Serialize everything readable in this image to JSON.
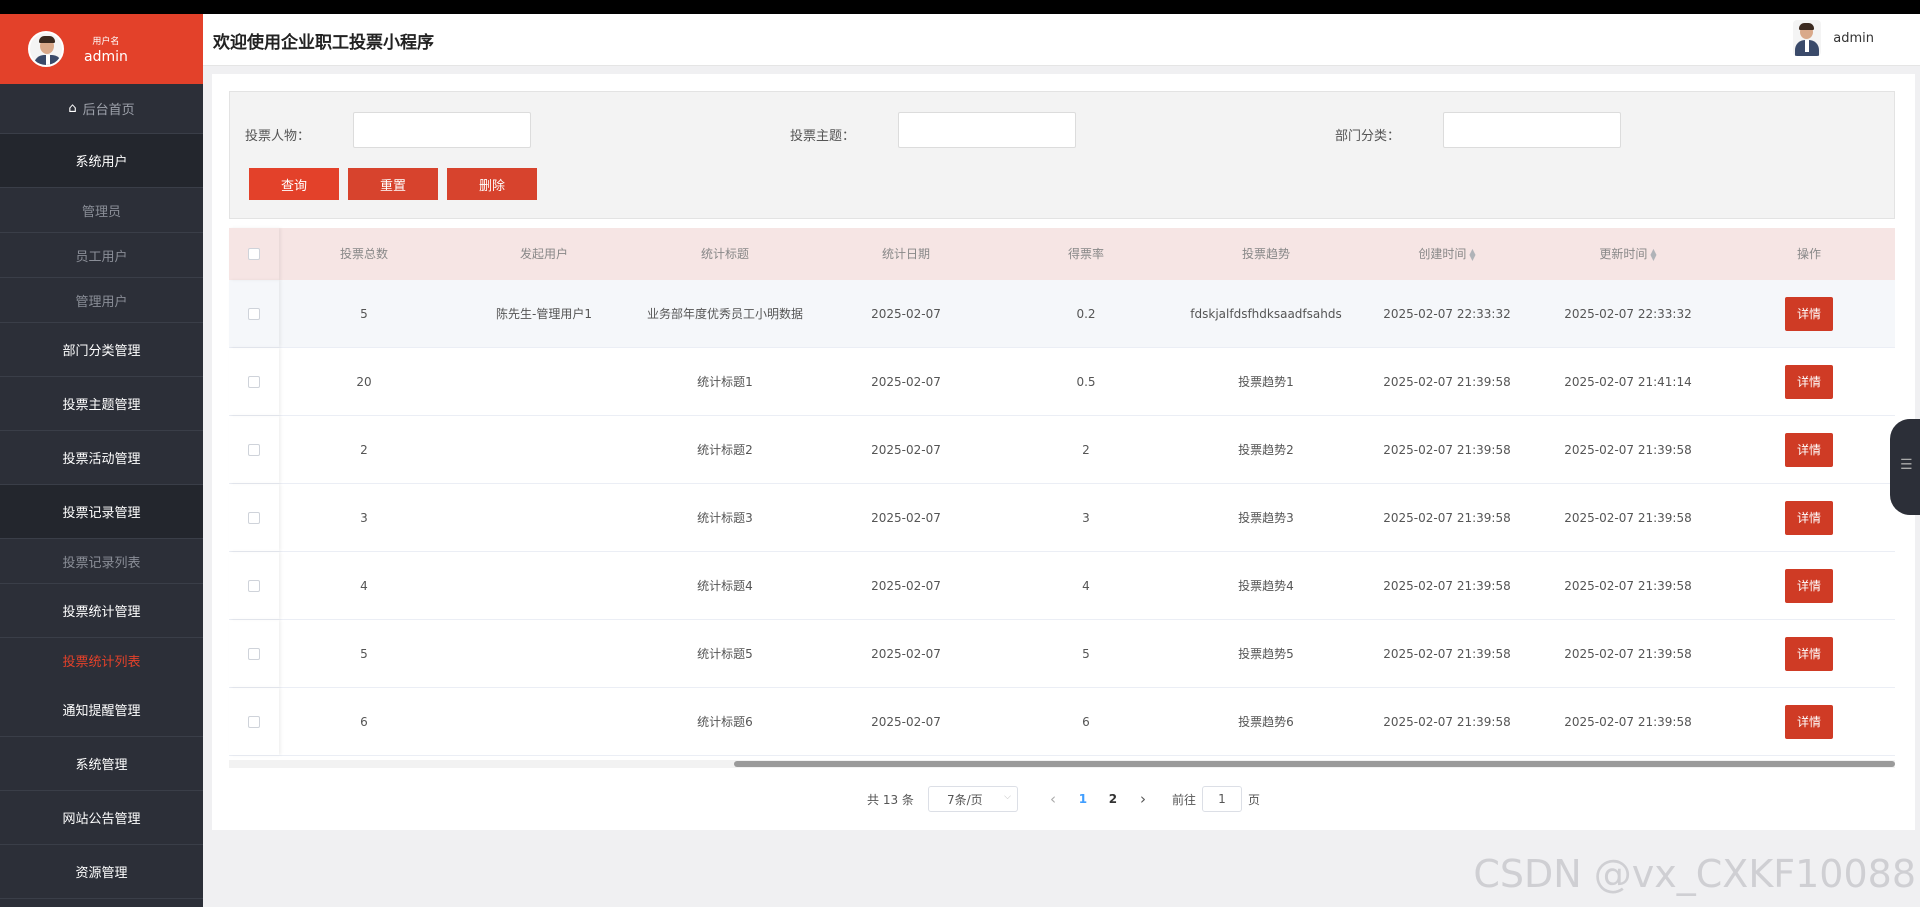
{
  "header": {
    "title": "欢迎使用企业职工投票小程序",
    "username": "admin"
  },
  "sidebar": {
    "user_label": "用户名",
    "user_name": "admin",
    "home": "后台首页",
    "items": [
      {
        "label": "系统用户",
        "type": "group"
      },
      {
        "label": "管理员",
        "type": "sub"
      },
      {
        "label": "员工用户",
        "type": "sub"
      },
      {
        "label": "管理用户",
        "type": "sub"
      },
      {
        "label": "部门分类管理",
        "type": "group"
      },
      {
        "label": "投票主题管理",
        "type": "group"
      },
      {
        "label": "投票活动管理",
        "type": "group"
      },
      {
        "label": "投票记录管理",
        "type": "group"
      },
      {
        "label": "投票记录列表",
        "type": "sub"
      },
      {
        "label": "投票统计管理",
        "type": "group"
      },
      {
        "label": "投票统计列表",
        "type": "sub-active"
      },
      {
        "label": "通知提醒管理",
        "type": "group"
      },
      {
        "label": "系统管理",
        "type": "group"
      },
      {
        "label": "网站公告管理",
        "type": "group"
      },
      {
        "label": "资源管理",
        "type": "group"
      }
    ]
  },
  "search": {
    "person_label": "投票人物：",
    "topic_label": "投票主题：",
    "dept_label": "部门分类：",
    "person_value": "",
    "topic_value": "",
    "dept_value": "",
    "query_btn": "查询",
    "reset_btn": "重置",
    "delete_btn": "删除"
  },
  "table": {
    "headers": [
      "投票总数",
      "发起用户",
      "统计标题",
      "统计日期",
      "得票率",
      "投票趋势",
      "创建时间",
      "更新时间",
      "操作"
    ],
    "detail_label": "详情",
    "rows": [
      {
        "total": "5",
        "user": "陈先生-管理用户1",
        "title": "业务部年度优秀员工小明数据",
        "date": "2025-02-07",
        "rate": "0.2",
        "trend": "fdskjalfdsfhdksaadfsahds",
        "created": "2025-02-07 22:33:32",
        "updated": "2025-02-07 22:33:32"
      },
      {
        "total": "20",
        "user": "",
        "title": "统计标题1",
        "date": "2025-02-07",
        "rate": "0.5",
        "trend": "投票趋势1",
        "created": "2025-02-07 21:39:58",
        "updated": "2025-02-07 21:41:14"
      },
      {
        "total": "2",
        "user": "",
        "title": "统计标题2",
        "date": "2025-02-07",
        "rate": "2",
        "trend": "投票趋势2",
        "created": "2025-02-07 21:39:58",
        "updated": "2025-02-07 21:39:58"
      },
      {
        "total": "3",
        "user": "",
        "title": "统计标题3",
        "date": "2025-02-07",
        "rate": "3",
        "trend": "投票趋势3",
        "created": "2025-02-07 21:39:58",
        "updated": "2025-02-07 21:39:58"
      },
      {
        "total": "4",
        "user": "",
        "title": "统计标题4",
        "date": "2025-02-07",
        "rate": "4",
        "trend": "投票趋势4",
        "created": "2025-02-07 21:39:58",
        "updated": "2025-02-07 21:39:58"
      },
      {
        "total": "5",
        "user": "",
        "title": "统计标题5",
        "date": "2025-02-07",
        "rate": "5",
        "trend": "投票趋势5",
        "created": "2025-02-07 21:39:58",
        "updated": "2025-02-07 21:39:58"
      },
      {
        "total": "6",
        "user": "",
        "title": "统计标题6",
        "date": "2025-02-07",
        "rate": "6",
        "trend": "投票趋势6",
        "created": "2025-02-07 21:39:58",
        "updated": "2025-02-07 21:39:58"
      }
    ]
  },
  "pager": {
    "total": "共 13 条",
    "page_size": "7条/页",
    "pages": [
      "1",
      "2"
    ],
    "current": "1",
    "goto_prefix": "前往",
    "goto_value": "1",
    "goto_suffix": "页"
  },
  "watermark": "CSDN @vx_CXKF10088",
  "colors": {
    "accent": "#e3412a",
    "sidebar": "#2c2f38",
    "table_header": "#f6e5e4"
  }
}
